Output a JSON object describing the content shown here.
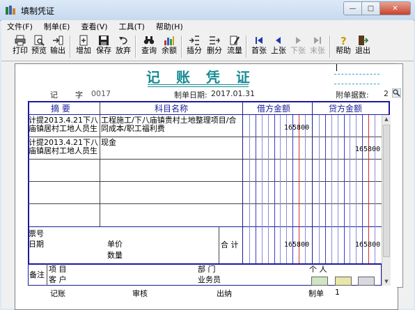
{
  "window": {
    "title": "填制凭证"
  },
  "menu": [
    "文件(F)",
    "制单(E)",
    "查看(V)",
    "工具(T)",
    "帮助(H)"
  ],
  "toolbar": {
    "print": "打印",
    "preview": "预览",
    "output": "输出",
    "add": "增加",
    "save": "保存",
    "abandon": "放弃",
    "query": "查询",
    "balance": "余额",
    "insert": "插分",
    "delete": "删分",
    "flow": "流量",
    "first": "首张",
    "prev": "上张",
    "next": "下张",
    "last": "末张",
    "help": "帮助",
    "exit": "退出"
  },
  "voucher": {
    "title": "记 账 凭 证",
    "type_label": "记",
    "no_label": "字",
    "no_value": "0017",
    "date_label": "制单日期:",
    "date_value": "2017.01.31",
    "attach_label": "附单据数:",
    "attach_value": "2"
  },
  "columns": {
    "summary": "摘 要",
    "account": "科目名称",
    "debit": "借方金额",
    "credit": "贷方金额"
  },
  "rows": [
    {
      "summary": "计提2013.4.21下八庙镇居村工地人员生",
      "account": "工程施工/下八庙镇贵村土地整理项目/合同成本/职工福利费",
      "debit": "165800",
      "credit": ""
    },
    {
      "summary": "计提2013.4.21下八庙镇居村工地人员生",
      "account": "现金",
      "debit": "",
      "credit": "165800"
    }
  ],
  "totals": {
    "ticket_no_label": "票号",
    "date_label": "日期",
    "unit_price_label": "单价",
    "quantity_label": "数量",
    "total_label": "合 计",
    "debit_total": "165800",
    "credit_total": "165800"
  },
  "remarks": {
    "remark_label": "备注",
    "project_label": "项 目",
    "dept_label": "部 门",
    "personal_label": "个 人",
    "customer_label": "客 户",
    "salesman_label": "业务员"
  },
  "footer": {
    "bookkeeping_label": "记账",
    "review_label": "审核",
    "cashier_label": "出纳",
    "maker_label": "制单",
    "maker_value": "1"
  }
}
